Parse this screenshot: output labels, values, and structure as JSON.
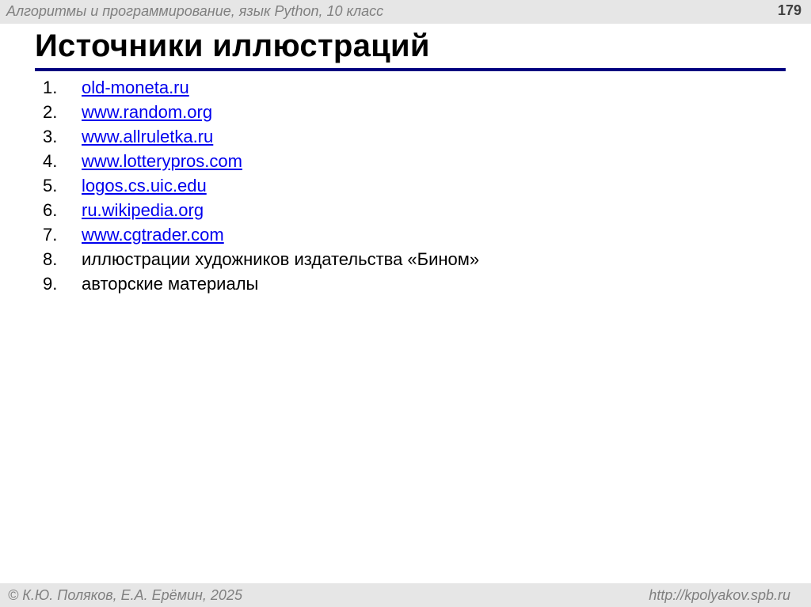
{
  "header": {
    "course_title": "Алгоритмы и программирование, язык Python, 10 класс",
    "page_number": "179"
  },
  "slide": {
    "title": "Источники иллюстраций"
  },
  "sources": [
    {
      "number": "1.",
      "text": "old-moneta.ru",
      "is_link": true
    },
    {
      "number": "2.",
      "text": "www.random.org",
      "is_link": true
    },
    {
      "number": "3.",
      "text": "www.allruletka.ru",
      "is_link": true
    },
    {
      "number": "4.",
      "text": "www.lotterypros.com",
      "is_link": true
    },
    {
      "number": "5.",
      "text": "logos.cs.uic.edu",
      "is_link": true
    },
    {
      "number": "6.",
      "text": "ru.wikipedia.org",
      "is_link": true
    },
    {
      "number": "7.",
      "text": "www.cgtrader.com",
      "is_link": true
    },
    {
      "number": "8.",
      "text": "иллюстрации художников издательства «Бином»",
      "is_link": false
    },
    {
      "number": "9.",
      "text": "авторские материалы",
      "is_link": false
    }
  ],
  "footer": {
    "copyright": "© К.Ю. Поляков, Е.А. Ерёмин, 2025",
    "url": "http://kpolyakov.spb.ru"
  },
  "colors": {
    "accent_rule": "#000080",
    "link": "#0000ee",
    "bar_background": "#e6e6e6"
  }
}
